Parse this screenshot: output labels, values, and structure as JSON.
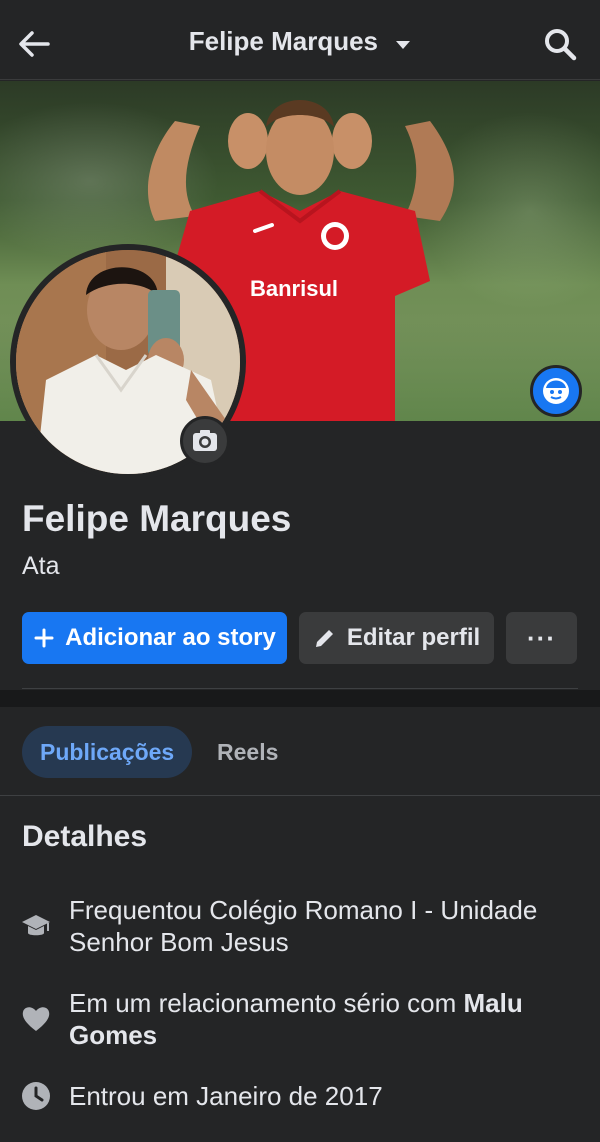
{
  "header": {
    "title": "Felipe Marques"
  },
  "profile": {
    "name": "Felipe Marques",
    "subtitle": "Ata",
    "cover_text": "Banrisul"
  },
  "actions": {
    "add_story": "Adicionar ao story",
    "edit_profile": "Editar perfil",
    "more": "···"
  },
  "tabs": [
    {
      "label": "Publicações",
      "active": true
    },
    {
      "label": "Reels",
      "active": false
    }
  ],
  "details": {
    "title": "Detalhes",
    "items": [
      {
        "icon": "graduation-cap-icon",
        "text": "Frequentou Colégio Romano I - Unidade Senhor Bom Jesus"
      },
      {
        "icon": "heart-icon",
        "text_prefix": "Em um relacionamento sério com ",
        "text_bold": "Malu Gomes"
      },
      {
        "icon": "clock-icon",
        "text": "Entrou em Janeiro de 2017"
      }
    ]
  },
  "colors": {
    "background": "#242526",
    "accent": "#1877f2",
    "tab_active_bg": "#263951",
    "tab_active_text": "#6ea8f8",
    "button_secondary": "#3a3b3c"
  }
}
